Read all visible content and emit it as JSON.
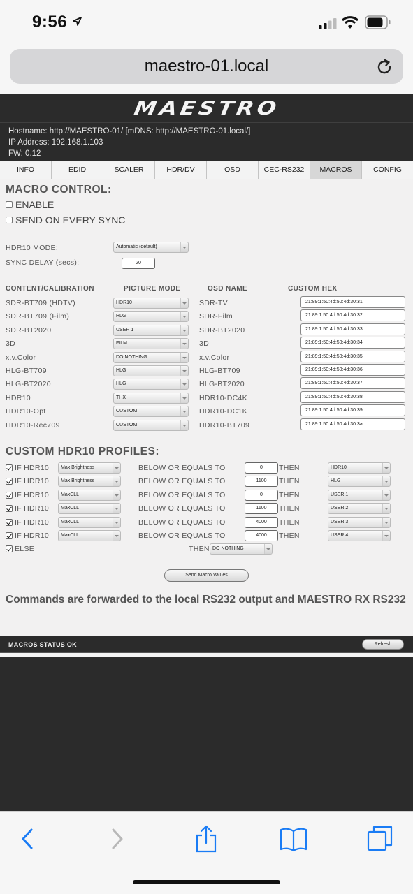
{
  "status": {
    "time": "9:56"
  },
  "browser": {
    "url": "maestro-01.local"
  },
  "header": {
    "logo": "MAESTRO",
    "hostname": "Hostname: http://MAESTRO-01/ [mDNS: http://MAESTRO-01.local/]",
    "ip": "IP Address: 192.168.1.103",
    "fw": "FW: 0.12"
  },
  "tabs": [
    {
      "label": "INFO"
    },
    {
      "label": "EDID"
    },
    {
      "label": "SCALER"
    },
    {
      "label": "HDR/DV"
    },
    {
      "label": "OSD"
    },
    {
      "label": "CEC-RS232"
    },
    {
      "label": "MACROS",
      "active": true
    },
    {
      "label": "CONFIG"
    }
  ],
  "macro": {
    "title": "MACRO CONTROL:",
    "enable": "ENABLE",
    "send_on_sync": "SEND ON EVERY SYNC",
    "hdr10_mode_label": "HDR10 MODE:",
    "hdr10_mode_value": "Automatic (default)",
    "sync_delay_label": "SYNC DELAY (secs):",
    "sync_delay_value": "20"
  },
  "table": {
    "headers": [
      "CONTENT/CALIBRATION",
      "PICTURE MODE",
      "OSD NAME",
      "CUSTOM HEX"
    ],
    "rows": [
      {
        "content": "SDR-BT709 (HDTV)",
        "mode": "HDR10",
        "osd": "SDR-TV",
        "hex": "21:89:1:50:4d:50:4d:30:31"
      },
      {
        "content": "SDR-BT709 (Film)",
        "mode": "HLG",
        "osd": "SDR-Film",
        "hex": "21:89:1:50:4d:50:4d:30:32"
      },
      {
        "content": "SDR-BT2020",
        "mode": "USER 1",
        "osd": "SDR-BT2020",
        "hex": "21:89:1:50:4d:50:4d:30:33"
      },
      {
        "content": "3D",
        "mode": "FILM",
        "osd": "3D",
        "hex": "21:89:1:50:4d:50:4d:30:34"
      },
      {
        "content": "x.v.Color",
        "mode": "DO NOTHING",
        "osd": "x.v.Color",
        "hex": "21:89:1:50:4d:50:4d:30:35"
      },
      {
        "content": "HLG-BT709",
        "mode": "HLG",
        "osd": "HLG-BT709",
        "hex": "21:89:1:50:4d:50:4d:30:36"
      },
      {
        "content": "HLG-BT2020",
        "mode": "HLG",
        "osd": "HLG-BT2020",
        "hex": "21:89:1:50:4d:50:4d:30:37"
      },
      {
        "content": "HDR10",
        "mode": "THX",
        "osd": "HDR10-DC4K",
        "hex": "21:89:1:50:4d:50:4d:30:38"
      },
      {
        "content": "HDR10-Opt",
        "mode": "CUSTOM",
        "osd": "HDR10-DC1K",
        "hex": "21:89:1:50:4d:50:4d:30:39"
      },
      {
        "content": "HDR10-Rec709",
        "mode": "CUSTOM",
        "osd": "HDR10-BT709",
        "hex": "21:89:1:50:4d:50:4d:30:3a"
      }
    ]
  },
  "profiles": {
    "title": "CUSTOM HDR10 PROFILES:",
    "if_label": "IF HDR10",
    "cond_label": "BELOW OR EQUALS TO",
    "then_label": "THEN",
    "rows": [
      {
        "metric": "Max Brightness",
        "value": "0",
        "result": "HDR10"
      },
      {
        "metric": "Max Brightness",
        "value": "1100",
        "result": "HLG"
      },
      {
        "metric": "MaxCLL",
        "value": "0",
        "result": "USER 1"
      },
      {
        "metric": "MaxCLL",
        "value": "1100",
        "result": "USER 2"
      },
      {
        "metric": "MaxCLL",
        "value": "4000",
        "result": "USER 3"
      },
      {
        "metric": "MaxCLL",
        "value": "4000",
        "result": "USER 4"
      }
    ],
    "else_label": "ELSE",
    "else_then": "THEN",
    "else_value": "DO NOTHING",
    "send_button": "Send Macro Values"
  },
  "note": "Commands are forwarded to the local RS232 output and MAESTRO RX RS232",
  "footer": {
    "status": "MACROS STATUS OK",
    "refresh": "Refresh"
  },
  "icons": {
    "back": "chevron-left-icon",
    "forward": "chevron-right-icon",
    "share": "share-icon",
    "bookmarks": "book-icon",
    "tabs": "tabs-icon",
    "reload": "reload-icon"
  },
  "colors": {
    "header_bg": "#2b2b2b",
    "ios_blue": "#1a7cf5",
    "active_tab": "#d7d7d7"
  }
}
